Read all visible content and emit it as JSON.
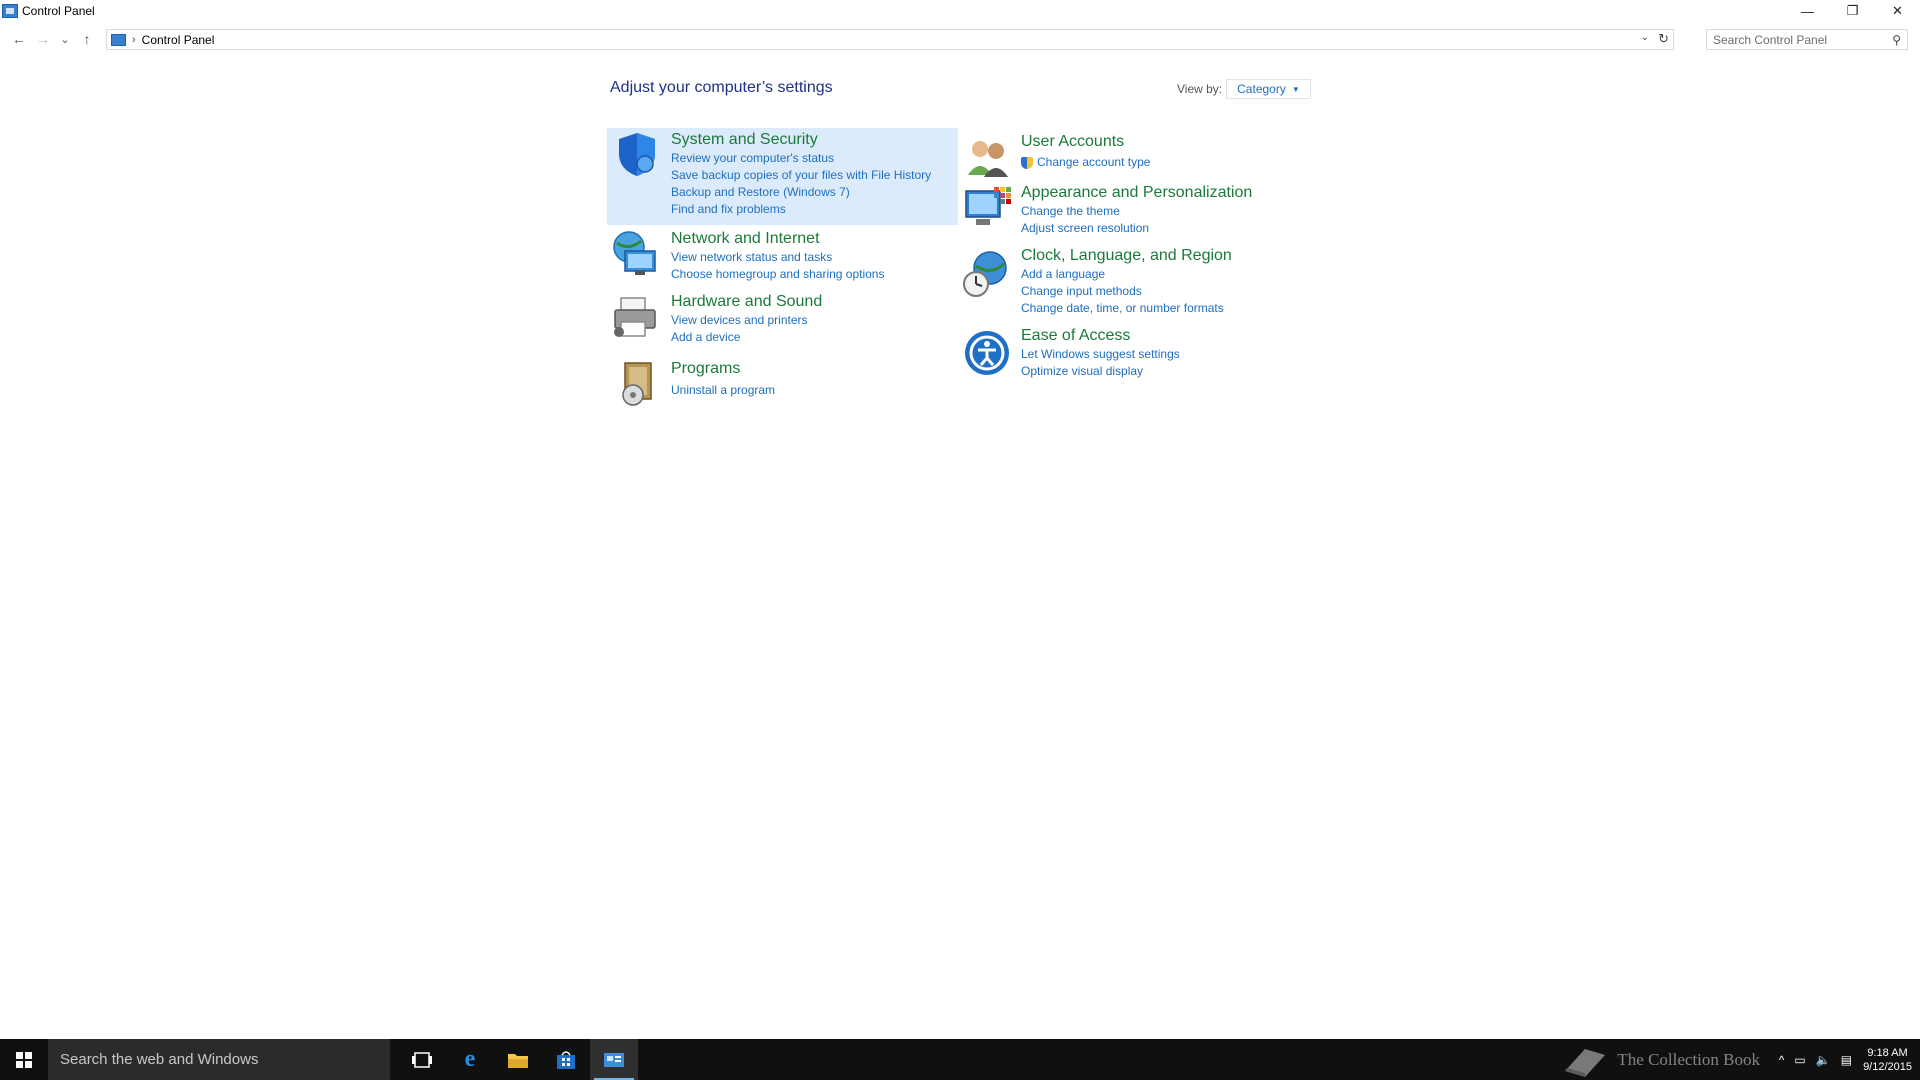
{
  "window": {
    "title": "Control Panel",
    "controls": {
      "minimize": "—",
      "restore": "❐",
      "close": "✕"
    }
  },
  "nav": {
    "back": "←",
    "forward": "→",
    "recent": "⌄",
    "up": "↑",
    "breadcrumb": "Control Panel",
    "search_placeholder": "Search Control Panel"
  },
  "main": {
    "heading": "Adjust your computer’s settings",
    "view_by_label": "View by:",
    "view_by_value": "Category"
  },
  "categories_left": [
    {
      "title": "System and Security",
      "icon": "shield-icon",
      "links": [
        "Review your computer's status",
        "Save backup copies of your files with File History",
        "Backup and Restore (Windows 7)",
        "Find and fix problems"
      ]
    },
    {
      "title": "Network and Internet",
      "icon": "network-globe-icon",
      "links": [
        "View network status and tasks",
        "Choose homegroup and sharing options"
      ]
    },
    {
      "title": "Hardware and Sound",
      "icon": "printer-icon",
      "links": [
        "View devices and printers",
        "Add a device"
      ]
    },
    {
      "title": "Programs",
      "icon": "programs-disc-icon",
      "links": [
        "Uninstall a program"
      ]
    }
  ],
  "categories_right": [
    {
      "title": "User Accounts",
      "icon": "users-icon",
      "links": [
        "Change account type"
      ]
    },
    {
      "title": "Appearance and Personalization",
      "icon": "monitor-palette-icon",
      "links": [
        "Change the theme",
        "Adjust screen resolution"
      ]
    },
    {
      "title": "Clock, Language, and Region",
      "icon": "clock-globe-icon",
      "links": [
        "Add a language",
        "Change input methods",
        "Change date, time, or number formats"
      ]
    },
    {
      "title": "Ease of Access",
      "icon": "ease-of-access-icon",
      "links": [
        "Let Windows suggest settings",
        "Optimize visual display"
      ]
    }
  ],
  "taskbar": {
    "search_text": "Search the web and Windows",
    "clock_time": "9:18 AM",
    "clock_date": "9/12/2015",
    "watermark": "The Collection Book"
  }
}
